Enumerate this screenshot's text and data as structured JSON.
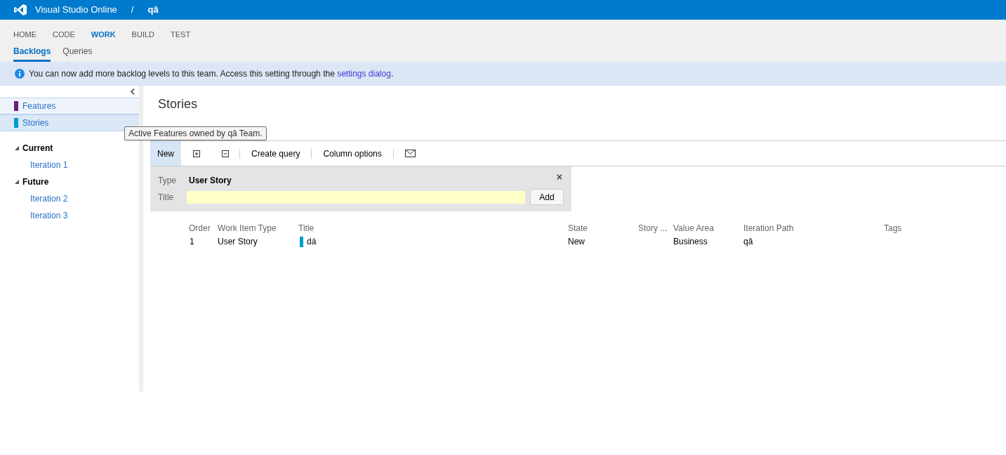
{
  "header": {
    "product": "Visual Studio Online",
    "separator": "/",
    "project": "qâ"
  },
  "nav": [
    {
      "label": "HOME",
      "selected": false
    },
    {
      "label": "CODE",
      "selected": false
    },
    {
      "label": "WORK",
      "selected": true
    },
    {
      "label": "BUILD",
      "selected": false
    },
    {
      "label": "TEST",
      "selected": false
    }
  ],
  "subnav": [
    {
      "label": "Backlogs",
      "selected": true
    },
    {
      "label": "Queries",
      "selected": false
    }
  ],
  "banner": {
    "text": "You can now add more backlog levels to this team. Access this setting through the ",
    "link": "settings dialog",
    "after": "."
  },
  "sidebar": {
    "backlogs": [
      {
        "label": "Features",
        "color": "#68217a",
        "selected": false
      },
      {
        "label": "Stories",
        "color": "#009ccc",
        "selected": true
      }
    ],
    "iterations": [
      {
        "label": "Current",
        "expanded": true,
        "children": [
          {
            "label": "Iteration 1"
          }
        ]
      },
      {
        "label": "Future",
        "expanded": true,
        "children": [
          {
            "label": "Iteration 2"
          },
          {
            "label": "Iteration 3"
          }
        ]
      }
    ]
  },
  "tooltip": "Active Features owned by qâ Team.",
  "page_title": "Stories",
  "toolbar": {
    "new": "New",
    "create_query": "Create query",
    "column_options": "Column options"
  },
  "add_panel": {
    "type_label": "Type",
    "type_value": "User Story",
    "title_label": "Title",
    "add": "Add",
    "close": "×"
  },
  "table": {
    "columns": [
      "Order",
      "Work Item Type",
      "Title",
      "State",
      "Story ...",
      "Value Area",
      "Iteration Path",
      "Tags"
    ],
    "rows": [
      {
        "order": "1",
        "type": "User Story",
        "title": "dá",
        "color": "#009ccc",
        "state": "New",
        "story_points": "",
        "value_area": "Business",
        "iteration": "qâ",
        "tags": ""
      }
    ]
  }
}
